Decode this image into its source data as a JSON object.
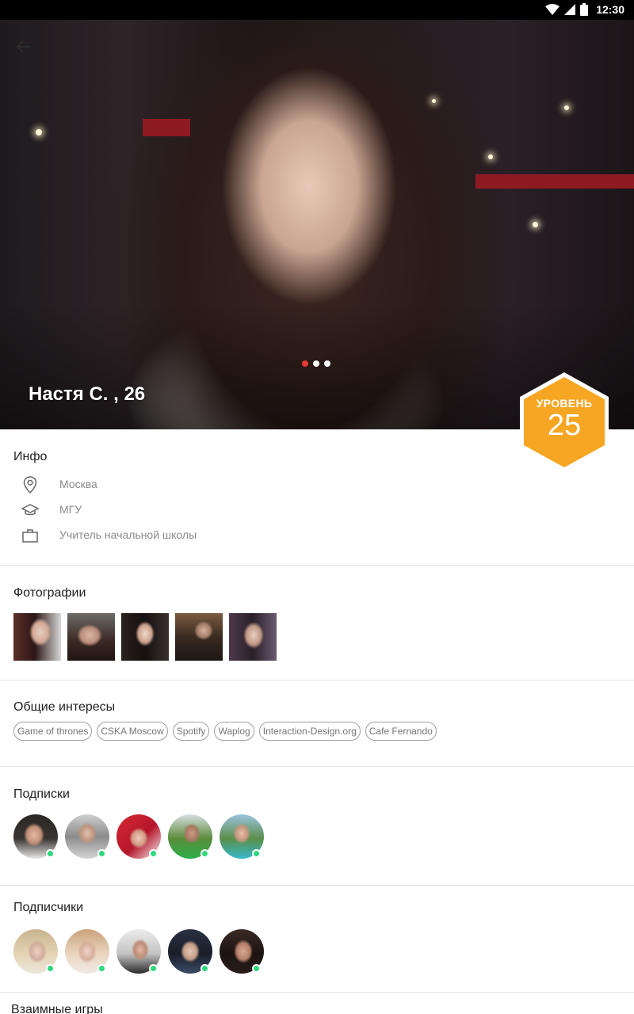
{
  "status_bar": {
    "time": "12:30",
    "icons": [
      "wifi-icon",
      "signal-icon",
      "battery-icon"
    ]
  },
  "header": {
    "back_icon": "arrow-back-icon"
  },
  "profile": {
    "name": "Настя С. , 26",
    "photo_count": 3,
    "active_photo": 0,
    "level_label": "УРОВЕНЬ",
    "level_value": "25"
  },
  "info": {
    "title": "Инфо",
    "items": [
      {
        "icon": "location-pin-icon",
        "text": "Москва"
      },
      {
        "icon": "graduation-cap-icon",
        "text": "МГУ"
      },
      {
        "icon": "briefcase-icon",
        "text": "Учитель начальной школы"
      }
    ]
  },
  "photos": {
    "title": "Фотографии",
    "count": 5
  },
  "interests": {
    "title": "Общие интересы",
    "items": [
      "Game of thrones",
      "CSKA Moscow",
      "Spotify",
      "Waplog",
      "Interaction-Design.org",
      "Cafe Fernando"
    ]
  },
  "subscriptions": {
    "title": "Подписки",
    "count": 5,
    "all_online": true
  },
  "subscribers": {
    "title": "Подписчики",
    "count": 5,
    "all_online": true
  },
  "next_section": {
    "title": "Взаимные игры"
  },
  "colors": {
    "level_badge": "#f6a623",
    "online": "#2fd87e",
    "active_dot": "#e53935",
    "divider": "#e3e3e3"
  }
}
